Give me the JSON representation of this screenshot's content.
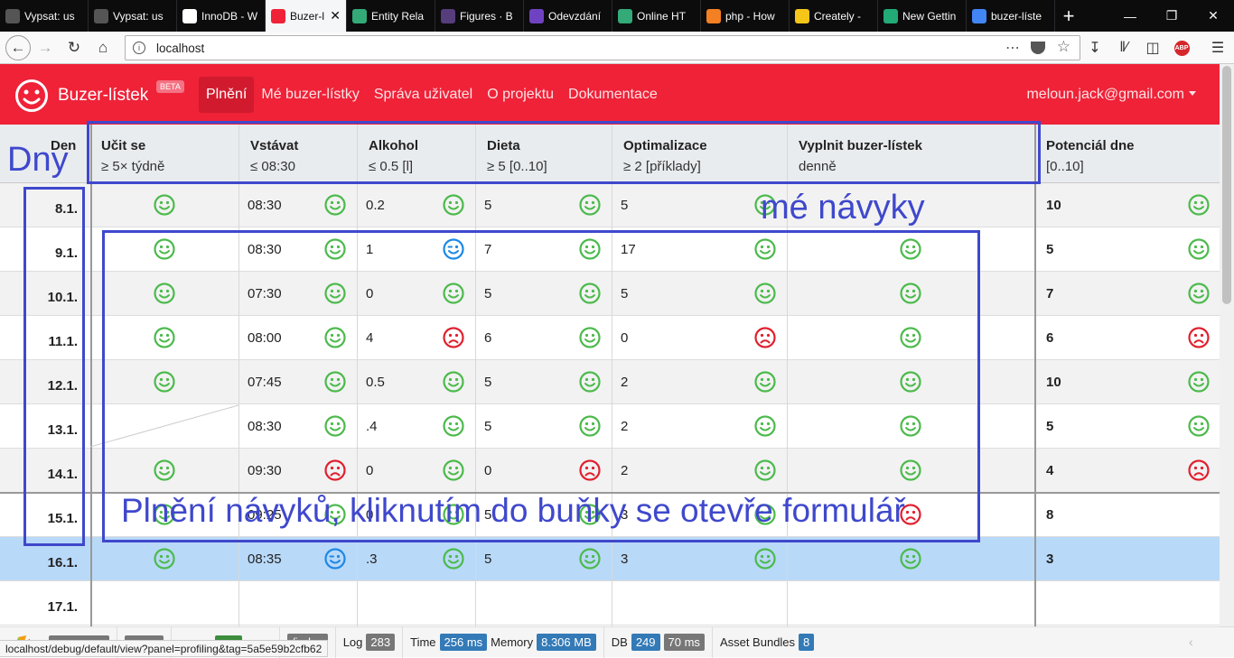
{
  "browser": {
    "tabs": [
      {
        "title": "Vypsat: us",
        "icon": "puzzle-icon",
        "color": "#555"
      },
      {
        "title": "Vypsat: us",
        "icon": "puzzle-icon",
        "color": "#555"
      },
      {
        "title": "InnoDB - W",
        "icon": "wikipedia-icon",
        "color": "#fff"
      },
      {
        "title": "Buzer-l",
        "icon": "smiley-icon",
        "color": "#ef2238",
        "active": true
      },
      {
        "title": "Entity Rela",
        "icon": "vp-icon",
        "color": "#3a7"
      },
      {
        "title": "Figures · B",
        "icon": "bootstrap-icon",
        "color": "#563d7c"
      },
      {
        "title": "Odevzdání",
        "icon": "list-icon",
        "color": "#6f42c1"
      },
      {
        "title": "Online HT",
        "icon": "code-icon",
        "color": "#3a7"
      },
      {
        "title": "php - How",
        "icon": "stack-icon",
        "color": "#f48024"
      },
      {
        "title": "Creately -",
        "icon": "bulb-icon",
        "color": "#f5c518"
      },
      {
        "title": "New Gettin",
        "icon": "doc-icon",
        "color": "#2a7"
      },
      {
        "title": "buzer-líste",
        "icon": "google-icon",
        "color": "#4285f4"
      }
    ],
    "url": "localhost"
  },
  "app": {
    "brand": "Buzer-lístek",
    "beta": "BETA",
    "nav": [
      "Plnění",
      "Mé buzer-lístky",
      "Správa uživatel",
      "O projektu",
      "Dokumentace"
    ],
    "user": "meloun.jack@gmail.com"
  },
  "table": {
    "day_header": "Den",
    "habits": [
      {
        "name": "Učit se",
        "sub": "≥ 5× týdně"
      },
      {
        "name": "Vstávat",
        "sub": "≤ 08:30"
      },
      {
        "name": "Alkohol",
        "sub": "≤ 0.5 [l]"
      },
      {
        "name": "Dieta",
        "sub": "≥ 5 [0..10]"
      },
      {
        "name": "Optimalizace",
        "sub": "≥ 2 [příklady]"
      },
      {
        "name": "Vyplnit buzer-lístek",
        "sub": "denně"
      }
    ],
    "potential_header": {
      "name": "Potenciál dne",
      "sub": "[0..10]"
    },
    "rows": [
      {
        "day": "8.1.",
        "vals": [
          "",
          "08:30",
          "0.2",
          "5",
          "5",
          ""
        ],
        "moods": [
          "happy",
          "happy",
          "happy",
          "happy",
          "happy",
          null
        ],
        "potential": "10",
        "pmood": "happy"
      },
      {
        "day": "9.1.",
        "vals": [
          "",
          "08:30",
          "1",
          "7",
          "17",
          ""
        ],
        "moods": [
          "happy",
          "happy",
          "wink",
          "happy",
          "happy",
          "happy"
        ],
        "potential": "5",
        "pmood": "happy"
      },
      {
        "day": "10.1.",
        "vals": [
          "",
          "07:30",
          "0",
          "5",
          "5",
          ""
        ],
        "moods": [
          "happy",
          "happy",
          "happy",
          "happy",
          "happy",
          "happy"
        ],
        "potential": "7",
        "pmood": "happy"
      },
      {
        "day": "11.1.",
        "vals": [
          "",
          "08:00",
          "4",
          "6",
          "0",
          ""
        ],
        "moods": [
          "happy",
          "happy",
          "sad",
          "happy",
          "sad",
          "happy"
        ],
        "potential": "6",
        "pmood": "sad"
      },
      {
        "day": "12.1.",
        "vals": [
          "",
          "07:45",
          "0.5",
          "5",
          "2",
          ""
        ],
        "moods": [
          "happy",
          "happy",
          "happy",
          "happy",
          "happy",
          "happy"
        ],
        "potential": "10",
        "pmood": "happy"
      },
      {
        "day": "13.1.",
        "vals": [
          "",
          "08:30",
          ".4",
          "5",
          "2",
          ""
        ],
        "moods": [
          null,
          "happy",
          "happy",
          "happy",
          "happy",
          "happy"
        ],
        "potential": "5",
        "pmood": "happy"
      },
      {
        "day": "14.1.",
        "vals": [
          "",
          "09:30",
          "0",
          "0",
          "2",
          ""
        ],
        "moods": [
          "happy",
          "sad",
          "happy",
          "sad",
          "happy",
          "happy"
        ],
        "potential": "4",
        "pmood": "sad"
      },
      {
        "day": "15.1.",
        "vals": [
          "",
          "09:25",
          "0",
          "5",
          "3",
          ""
        ],
        "moods": [
          "happy",
          "happy",
          "happy",
          "happy",
          "happy",
          "sad"
        ],
        "potential": "8",
        "pmood": null
      },
      {
        "day": "16.1.",
        "vals": [
          "",
          "08:35",
          ".3",
          "5",
          "3",
          ""
        ],
        "moods": [
          "happy",
          "wink",
          "happy",
          "happy",
          "happy",
          "happy"
        ],
        "potential": "3",
        "pmood": null,
        "selected": true
      },
      {
        "day": "17.1.",
        "vals": [
          "",
          "",
          "",
          "",
          "",
          ""
        ],
        "moods": [
          null,
          null,
          null,
          null,
          null,
          null
        ],
        "potential": "",
        "pmood": null
      }
    ]
  },
  "annotations": {
    "dny": "Dny",
    "me_navyky": "mé návyky",
    "plneni": "Plnění návyků, kliknutím do buňky se otevře formulář",
    "color": "#3f48cc"
  },
  "debugbar": {
    "index": "/index",
    "log_label": "Log",
    "log": "283",
    "time_label": "Time",
    "time": "256 ms",
    "memory_label": "Memory",
    "memory": "8.306 MB",
    "db_label": "DB",
    "db": "249",
    "db_time": "70 ms",
    "assets_label": "Asset Bundles",
    "assets": "8"
  },
  "status_url": "localhost/debug/default/view?panel=profiling&tag=5a5e59b2cfb62",
  "colors": {
    "happy": "#4cba4c",
    "sad": "#e0202e",
    "wink": "#1e88e5",
    "brand": "#ef2238",
    "selected_row": "#b9d9f8"
  }
}
